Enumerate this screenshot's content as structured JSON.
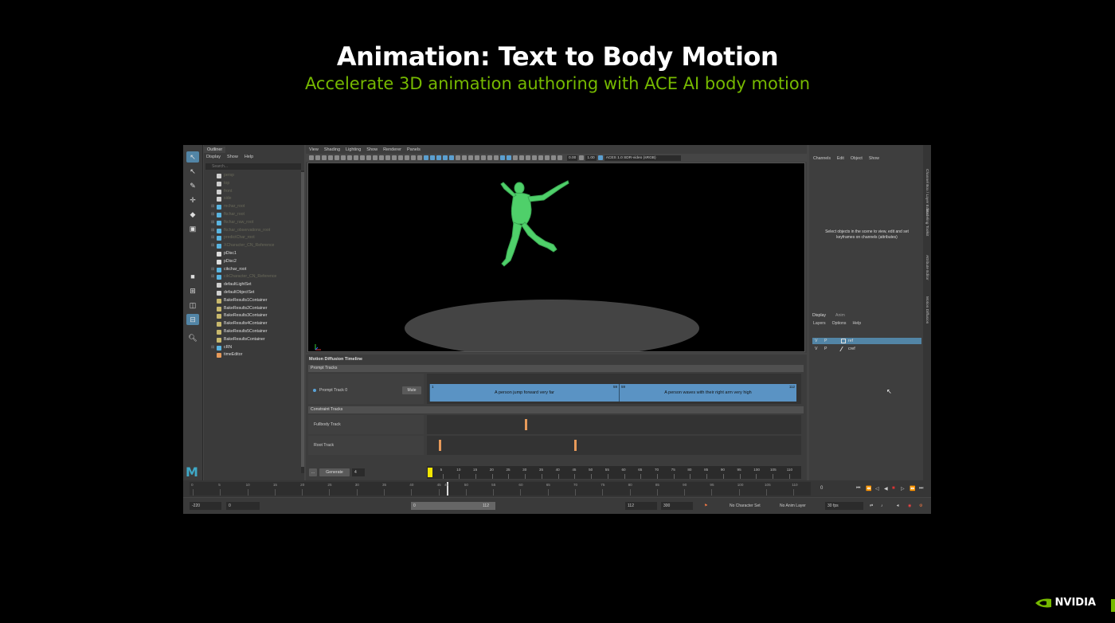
{
  "slide": {
    "title": "Animation: Text to Body Motion",
    "subtitle": "Accelerate 3D animation authoring with ACE AI body motion",
    "logo_text": "NVIDIA",
    "accent_color": "#76b900"
  },
  "outliner": {
    "tab": "Outliner",
    "menu": [
      "Display",
      "Show",
      "Help"
    ],
    "search_placeholder": "Search...",
    "items": [
      {
        "label": "persp",
        "icon": "camera-icon",
        "dim": true
      },
      {
        "label": "top",
        "icon": "camera-icon",
        "dim": true
      },
      {
        "label": "front",
        "icon": "camera-icon",
        "dim": true
      },
      {
        "label": "side",
        "icon": "camera-icon",
        "dim": true
      },
      {
        "label": "mchar_root",
        "icon": "joint-icon",
        "dim": true,
        "expand": true
      },
      {
        "label": "fkchar_root",
        "icon": "joint-icon",
        "dim": true,
        "expand": true
      },
      {
        "label": "fkchar_raw_root",
        "icon": "joint-icon",
        "dim": true,
        "expand": true
      },
      {
        "label": "fkchar_observations_root",
        "icon": "joint-icon",
        "dim": true,
        "expand": true
      },
      {
        "label": "predictChar_root",
        "icon": "joint-icon",
        "dim": true,
        "expand": true
      },
      {
        "label": "XCharacter_CN_Reference",
        "icon": "joint-icon",
        "dim": true,
        "expand": true
      },
      {
        "label": "pDisc1",
        "icon": "mesh-icon",
        "dim": false
      },
      {
        "label": "pDisc2",
        "icon": "mesh-icon",
        "dim": false
      },
      {
        "label": "cikchar_root",
        "icon": "joint-icon",
        "dim": false,
        "expand": true
      },
      {
        "label": "cikCharacter_CN_Reference",
        "icon": "joint-icon",
        "dim": true,
        "expand": true
      },
      {
        "label": "defaultLightSet",
        "icon": "set-icon",
        "dim": false
      },
      {
        "label": "defaultObjectSet",
        "icon": "set-icon",
        "dim": false
      },
      {
        "label": "BakeResults1Container",
        "icon": "container-icon",
        "dim": false
      },
      {
        "label": "BakeResults2Container",
        "icon": "container-icon",
        "dim": false
      },
      {
        "label": "BakeResults3Container",
        "icon": "container-icon",
        "dim": false
      },
      {
        "label": "BakeResults4Container",
        "icon": "container-icon",
        "dim": false
      },
      {
        "label": "BakeResults5Container",
        "icon": "container-icon",
        "dim": false
      },
      {
        "label": "BakeResultsContainer",
        "icon": "container-icon",
        "dim": false
      },
      {
        "label": "cRN",
        "icon": "reference-icon",
        "dim": false,
        "expand": true
      },
      {
        "label": "timeEditor",
        "icon": "editor-icon",
        "dim": false
      }
    ]
  },
  "viewport": {
    "menu": [
      "View",
      "Shading",
      "Lighting",
      "Show",
      "Renderer",
      "Panels"
    ],
    "field_a": "0.00",
    "field_b": "1.00",
    "color_space": "ACES 1.0 SDR-video (sRGB)"
  },
  "timeline_panel": {
    "title": "Motion Diffusion Timeline",
    "prompt_section": "Prompt Tracks",
    "prompt_track_label": "Prompt Track 0",
    "mute_label": "Mute",
    "clips": [
      {
        "text": "A person jump forward very far",
        "start": "1",
        "end": "59"
      },
      {
        "text": "A person waves with their right arm very high",
        "start": "59",
        "end": "112"
      }
    ],
    "constraint_section": "Constraint Tracks",
    "fullbody_label": "Fullbody Track",
    "root_label": "Root Track",
    "generate_label": "Generate",
    "generate_count": "4",
    "more_label": "...",
    "ruler_ticks": [
      "5",
      "10",
      "15",
      "20",
      "25",
      "30",
      "35",
      "40",
      "45",
      "50",
      "55",
      "60",
      "65",
      "70",
      "75",
      "80",
      "85",
      "90",
      "95",
      "100",
      "105",
      "110"
    ],
    "fullbody_keys": [
      30
    ],
    "root_keys": [
      4,
      45
    ]
  },
  "channel_box": {
    "menu": [
      "Channels",
      "Edit",
      "Object",
      "Show"
    ],
    "message": "Select objects in the scene to view, edit and set keyframes on channels (attributes)",
    "layer_tabs": [
      "Display",
      "Anim"
    ],
    "layer_menu": [
      "Layers",
      "Options",
      "Help"
    ],
    "layers": [
      {
        "v": "V",
        "p": "P",
        "name": "ref",
        "selected": true
      },
      {
        "v": "V",
        "p": "P",
        "name": "cref",
        "selected": false
      }
    ],
    "side_tabs": [
      "Channel Box / Layer Editor",
      "Modeling Toolkit",
      "Attribute Editor",
      "Motion Diffusion"
    ]
  },
  "time_slider": {
    "ticks": [
      "0",
      "5",
      "10",
      "15",
      "20",
      "25",
      "30",
      "35",
      "40",
      "45",
      "50",
      "55",
      "60",
      "65",
      "70",
      "75",
      "80",
      "85",
      "90",
      "95",
      "100",
      "105",
      "110"
    ],
    "current_frame": "46",
    "frame_field": "0"
  },
  "range_bar": {
    "start_outer": "-220",
    "start_inner": "0",
    "slider_start": "0",
    "slider_end": "112",
    "end_inner": "112",
    "end_outer": "300",
    "character_set": "No Character Set",
    "anim_layer": "No Anim Layer",
    "fps": "30 fps"
  }
}
